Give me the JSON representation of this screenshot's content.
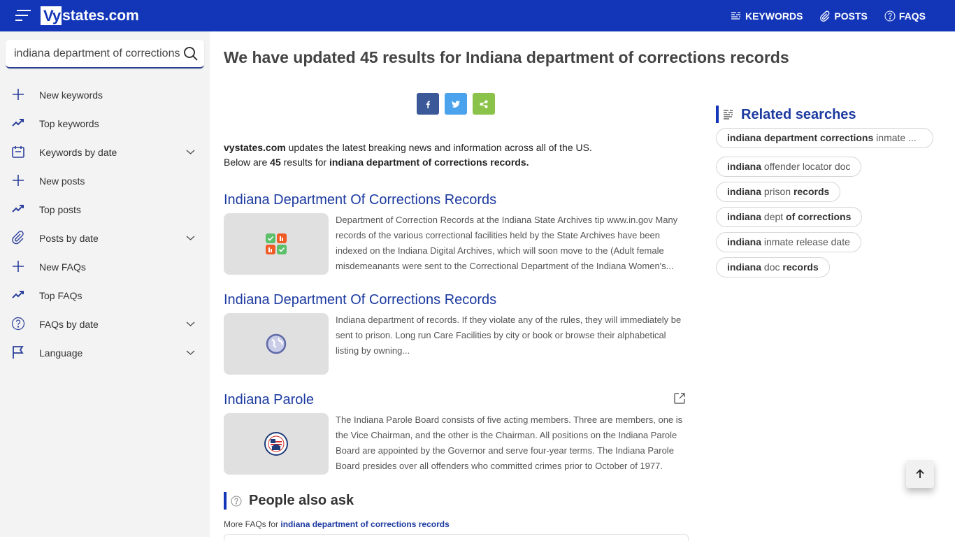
{
  "header": {
    "logo_box": "Vy",
    "logo_text": "states.com",
    "nav": [
      {
        "label": "KEYWORDS",
        "icon": "list-icon"
      },
      {
        "label": "POSTS",
        "icon": "paperclip-icon"
      },
      {
        "label": "FAQS",
        "icon": "question-circle-icon"
      }
    ]
  },
  "sidebar": {
    "search_value": "indiana department of corrections records",
    "items": [
      {
        "label": "New keywords",
        "icon": "plus-icon",
        "expandable": false
      },
      {
        "label": "Top keywords",
        "icon": "trending-up-icon",
        "expandable": false
      },
      {
        "label": "Keywords by date",
        "icon": "calendar-icon",
        "expandable": true
      },
      {
        "label": "New posts",
        "icon": "plus-icon",
        "expandable": false
      },
      {
        "label": "Top posts",
        "icon": "trending-up-icon",
        "expandable": false
      },
      {
        "label": "Posts by date",
        "icon": "paperclip-icon",
        "expandable": true
      },
      {
        "label": "New FAQs",
        "icon": "plus-icon",
        "expandable": false
      },
      {
        "label": "Top FAQs",
        "icon": "trending-up-icon",
        "expandable": false
      },
      {
        "label": "FAQs by date",
        "icon": "question-circle-icon",
        "expandable": true
      },
      {
        "label": "Language",
        "icon": "flag-icon",
        "expandable": true
      }
    ]
  },
  "main": {
    "title": "We have updated 45 results for Indiana department of corrections records",
    "share": {
      "facebook": "f",
      "colors": {
        "facebook": "#3b5998",
        "twitter": "#4aa3ec",
        "share": "#8bc34a"
      }
    },
    "intro": {
      "site": "vystates.com",
      "line1_rest": " updates the latest breaking news and information across all of the US.",
      "line2_pre": "Below are ",
      "count": "45",
      "line2_mid": " results for ",
      "query": "indiana department of corrections records."
    },
    "results": [
      {
        "title": "Indiana Department Of Corrections Records",
        "snippet": "Department of Correction Records at the Indiana State Archives tip www.in.gov Many records of the various correctional facilities held by the State Archives have been indexed on the Indiana Digital Archives, which will soon move to the (Adult female misdemeanants were sent to the Correctional Department of the Indiana Women's...",
        "thumb_icon": "records-grid-icon"
      },
      {
        "title": "Indiana Department Of Corrections Records",
        "snippet": "Indiana department of records. If they violate any of the rules, they will immediately be sent to prison. Long run Care Facilities by city or book or browse their alphabetical listing by owning...",
        "thumb_icon": "globe-icon"
      },
      {
        "title": "Indiana Parole",
        "snippet": "The Indiana Parole Board consists of five acting members. Three are members, one is the Vice Chairman, and the other is the Chairman. All positions on the Indiana Parole Board are appointed by the Governor and serve four-year terms. The Indiana Parole Board presides over all offenders who committed crimes prior to October of 1977.",
        "thumb_icon": "government-seal-icon"
      }
    ],
    "paa": {
      "title": "People also ask",
      "more_prefix": "More FAQs for ",
      "more_link": "indiana department of corrections records"
    }
  },
  "related": {
    "title": "Related searches",
    "chips": [
      [
        {
          "t": "indiana department corrections",
          "b": true
        },
        {
          "t": " inmate ...",
          "b": false
        }
      ],
      [
        {
          "t": "indiana",
          "b": true
        },
        {
          "t": " offender locator doc",
          "b": false
        }
      ],
      [
        {
          "t": "indiana",
          "b": true
        },
        {
          "t": " prison ",
          "b": false
        },
        {
          "t": "records",
          "b": true
        }
      ],
      [
        {
          "t": "indiana",
          "b": true
        },
        {
          "t": " dept ",
          "b": false
        },
        {
          "t": "of corrections",
          "b": true
        }
      ],
      [
        {
          "t": "indiana",
          "b": true
        },
        {
          "t": " inmate release date",
          "b": false
        }
      ],
      [
        {
          "t": "indiana",
          "b": true
        },
        {
          "t": " doc ",
          "b": false
        },
        {
          "t": "records",
          "b": true
        }
      ]
    ]
  },
  "colors": {
    "brand": "#1336b9",
    "link": "#1c3aa0",
    "sidebar_bg": "#f3f3f3"
  }
}
